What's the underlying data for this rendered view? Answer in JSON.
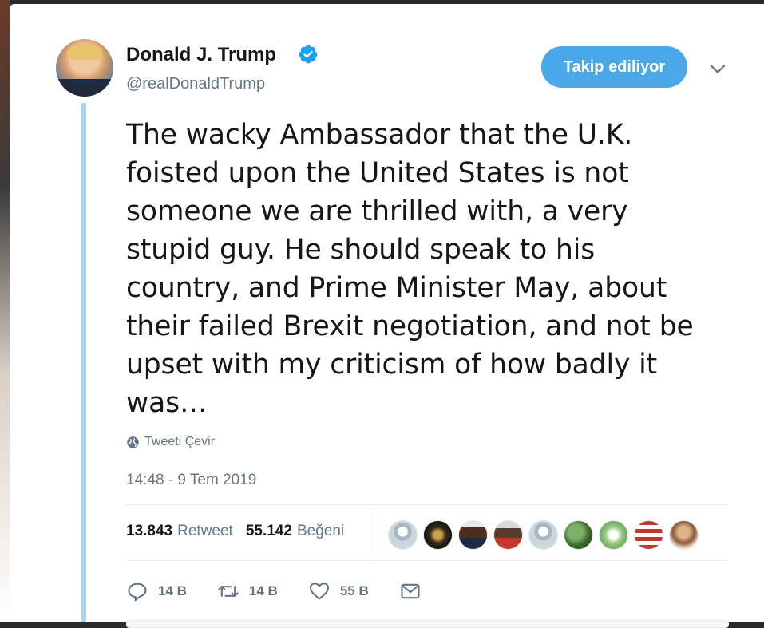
{
  "user": {
    "name": "Donald J. Trump",
    "handle": "@realDonaldTrump"
  },
  "follow_button": {
    "label": "Takip ediliyor"
  },
  "tweet": {
    "lines": [
      "The wacky Ambassador that the U.K.",
      "foisted upon the United States is not",
      "someone we are thrilled with, a very",
      "stupid guy. He should speak to his",
      "country, and Prime Minister May, about",
      "their failed Brexit negotiation, and not be",
      "upset with my criticism of how badly it",
      "was…"
    ]
  },
  "translate": {
    "label": "Tweeti Çevir"
  },
  "timestamp": "14:48 - 9 Tem 2019",
  "stats": {
    "retweets": {
      "value": "13.843",
      "label": "Retweet"
    },
    "likes": {
      "value": "55.142",
      "label": "Beğeni"
    }
  },
  "actions": {
    "reply": {
      "count": "14 B"
    },
    "retweet": {
      "count": "14 B"
    },
    "like": {
      "count": "55 B"
    }
  },
  "colors": {
    "accent": "#4aa8e8",
    "thread_line": "#a8d4f0",
    "secondary_text": "#657786",
    "primary_text": "#14171a"
  }
}
